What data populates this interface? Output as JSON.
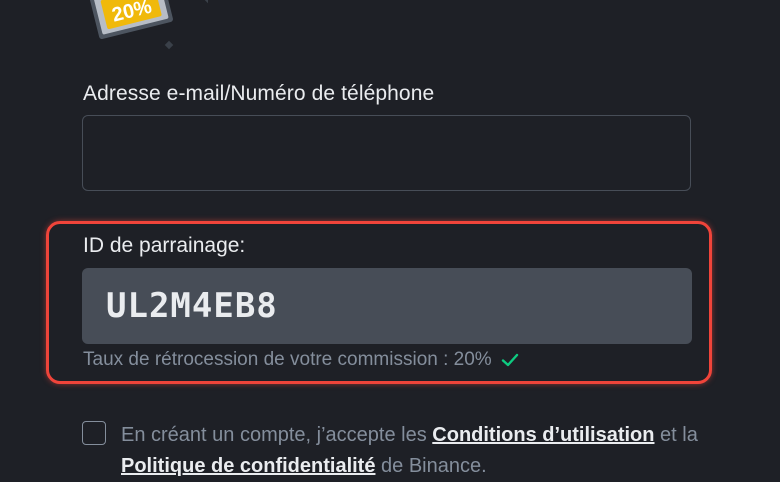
{
  "promo": {
    "icon": "discount-badge-icon",
    "text": "20%"
  },
  "email": {
    "label": "Adresse e-mail/Numéro de téléphone",
    "value": "",
    "placeholder": ""
  },
  "referral": {
    "label": "ID de parrainage:",
    "value": "UL2M4EB8",
    "commission_text": "Taux de rétrocession de votre commission : 20%",
    "check_icon": "check-icon"
  },
  "terms": {
    "prefix": "En créant un compte, j’accepte les ",
    "conditions_link": "Conditions d’utilisation",
    "middle": " et la ",
    "privacy_link": "Politique de confidentialité",
    "suffix": " de Binance."
  },
  "colors": {
    "background": "#1e2026",
    "highlight_border": "#f0443a",
    "input_filled": "#474d57",
    "success": "#0ecb81",
    "badge": "#fcd535"
  }
}
